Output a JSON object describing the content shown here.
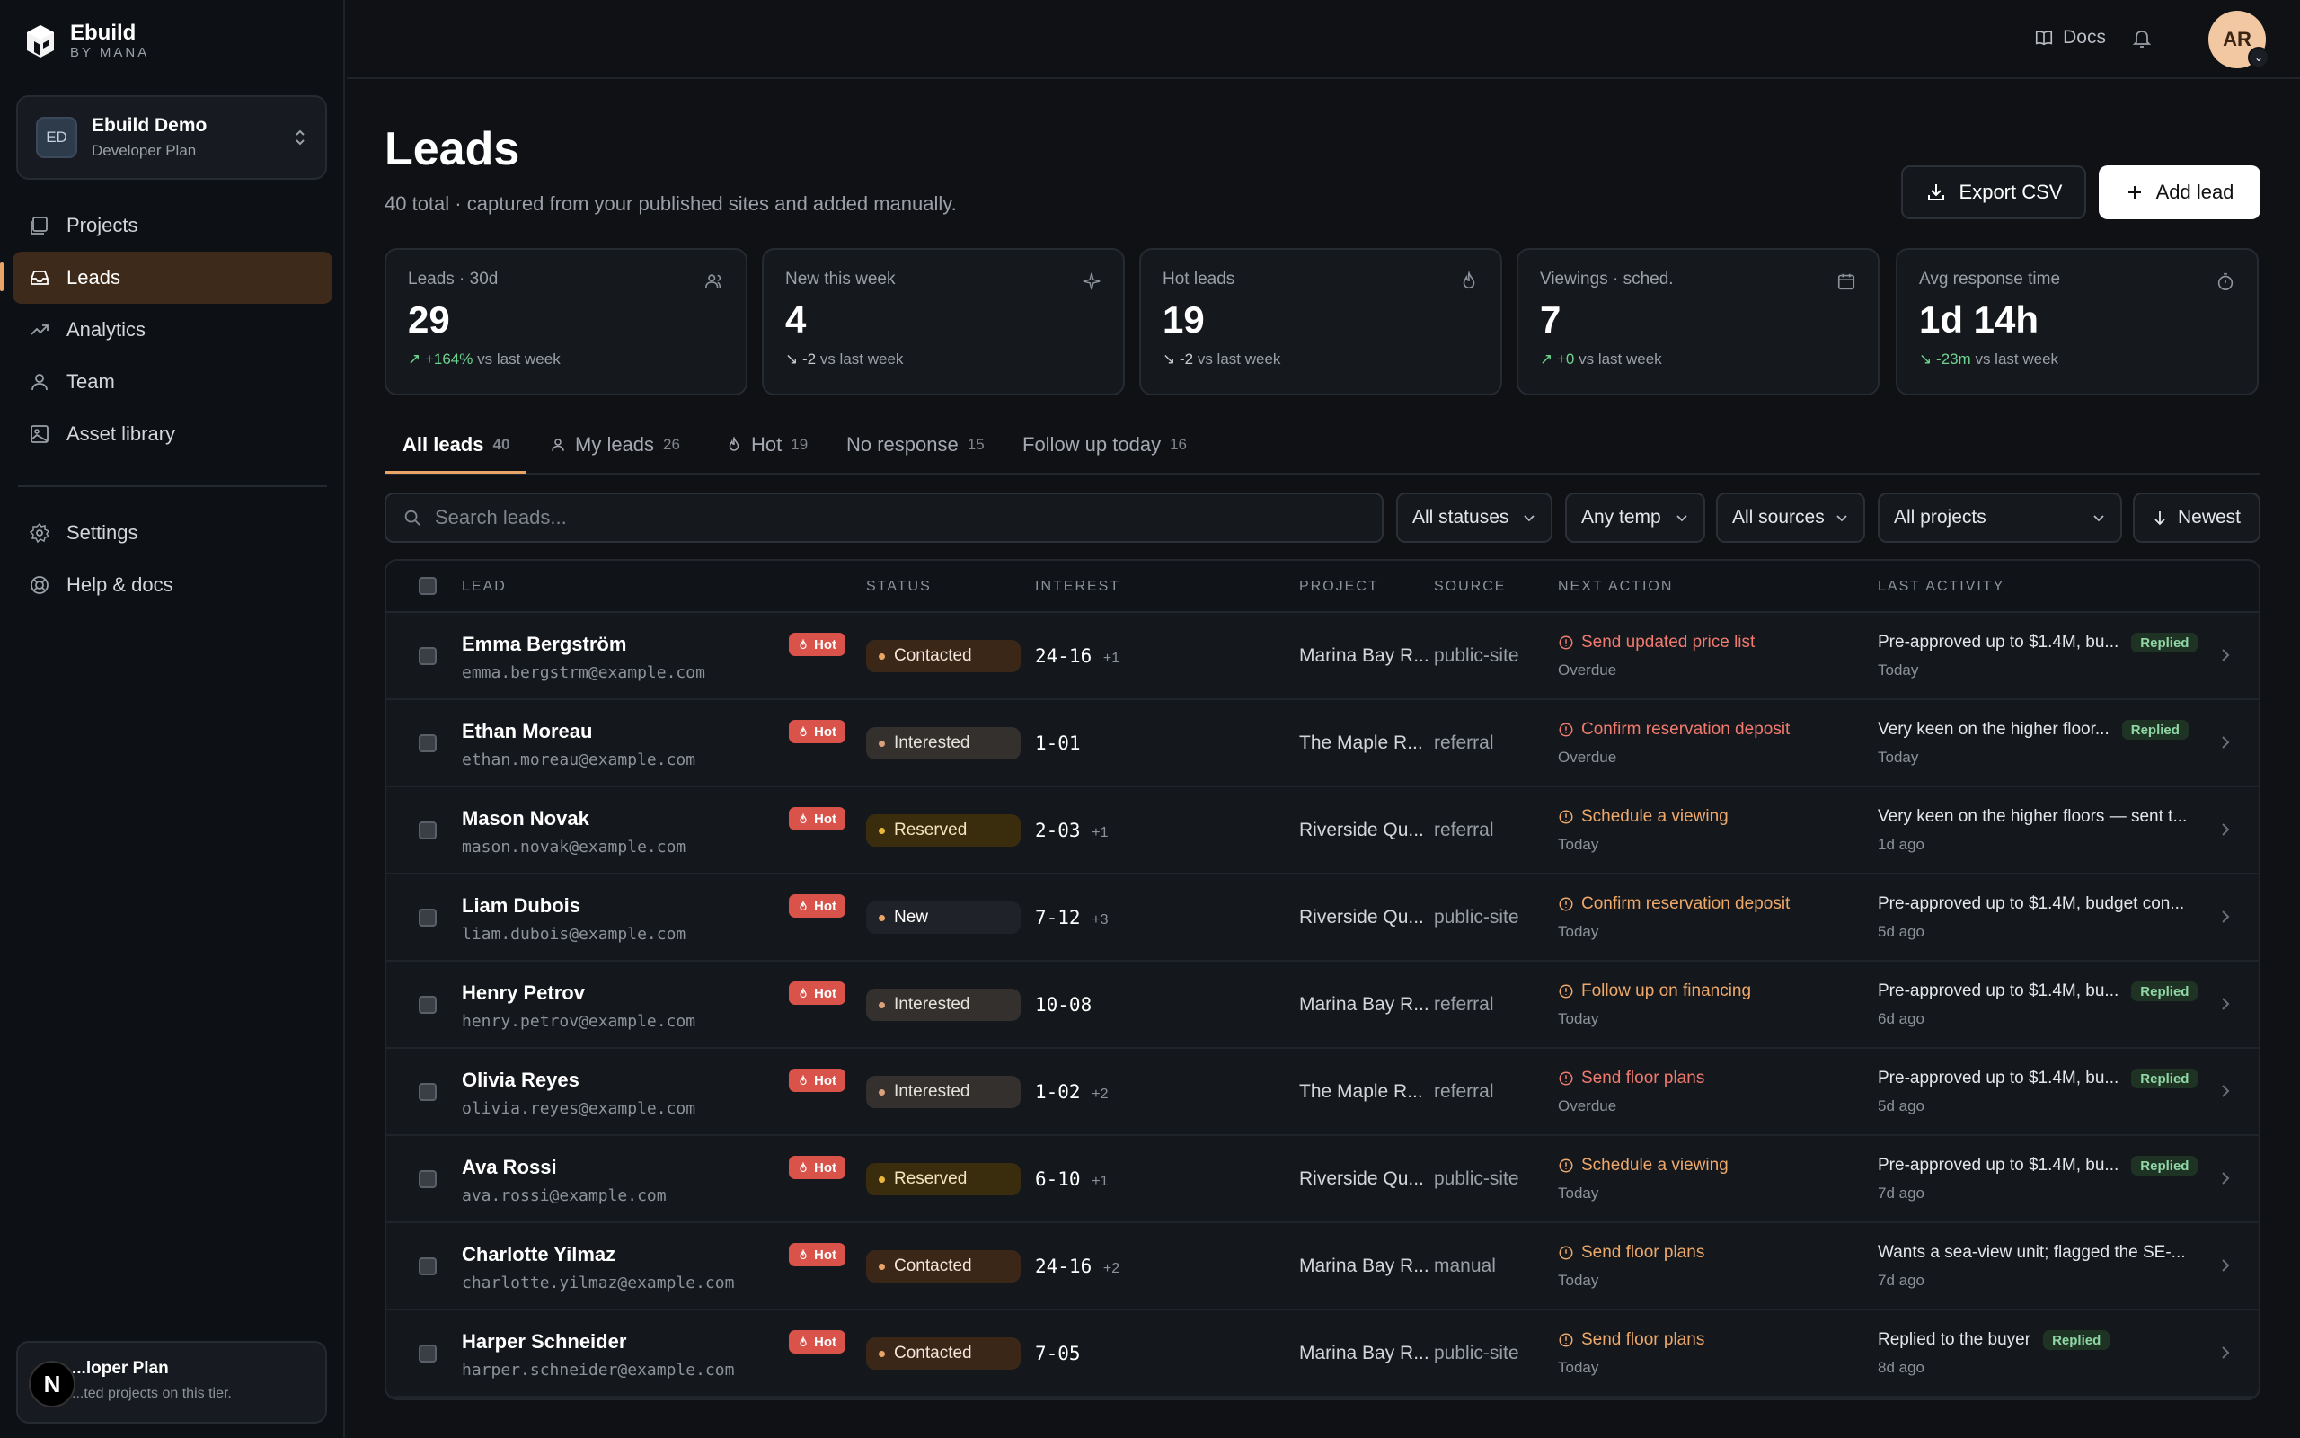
{
  "brand": {
    "name": "Ebuild",
    "sub": "BY MANA"
  },
  "workspace": {
    "initials": "ED",
    "name": "Ebuild Demo",
    "plan": "Developer Plan"
  },
  "nav": {
    "projects": "Projects",
    "leads": "Leads",
    "analytics": "Analytics",
    "team": "Team",
    "assets": "Asset library",
    "settings": "Settings",
    "help": "Help & docs"
  },
  "plan_card": {
    "badge": "N",
    "title": "...loper Plan",
    "sub": "...ted projects on this tier."
  },
  "topbar": {
    "docs": "Docs",
    "avatar": "AR"
  },
  "header": {
    "title": "Leads",
    "subtitle": "40 total · captured from your published sites and added manually.",
    "export": "Export CSV",
    "add": "Add lead"
  },
  "stats": [
    {
      "label": "Leads · 30d",
      "value": "29",
      "delta": "+164%",
      "delta_suffix": "vs last week",
      "dir": "up"
    },
    {
      "label": "New this week",
      "value": "4",
      "delta": "-2",
      "delta_suffix": "vs last week",
      "dir": "down"
    },
    {
      "label": "Hot leads",
      "value": "19",
      "delta": "-2",
      "delta_suffix": "vs last week",
      "dir": "down"
    },
    {
      "label": "Viewings · sched.",
      "value": "7",
      "delta": "+0",
      "delta_suffix": "vs last week",
      "dir": "up"
    },
    {
      "label": "Avg response time",
      "value": "1d 14h",
      "delta": "-23m",
      "delta_suffix": "vs last week",
      "dir": "up"
    }
  ],
  "tabs": [
    {
      "label": "All leads",
      "count": "40"
    },
    {
      "label": "My leads",
      "count": "26"
    },
    {
      "label": "Hot",
      "count": "19"
    },
    {
      "label": "No response",
      "count": "15"
    },
    {
      "label": "Follow up today",
      "count": "16"
    }
  ],
  "filters": {
    "search_placeholder": "Search leads...",
    "status": "All statuses",
    "temp": "Any temp",
    "source": "All sources",
    "project": "All projects",
    "sort": "Newest"
  },
  "columns": {
    "lead": "LEAD",
    "status": "STATUS",
    "interest": "INTEREST",
    "project": "PROJECT",
    "source": "SOURCE",
    "next": "NEXT ACTION",
    "last": "LAST ACTIVITY"
  },
  "hot_label": "Hot",
  "replied_label": "Replied",
  "rows": [
    {
      "name": "Emma Bergström",
      "email": "emma.bergstrm@example.com",
      "status": "Contacted",
      "status_key": "contacted",
      "unit": "24-16",
      "more": "+1",
      "project": "Marina Bay R...",
      "source": "public-site",
      "action": "Send updated price list",
      "action_type": "overdue",
      "action_when": "Overdue",
      "activity": "Pre-approved up to $1.4M, bu...",
      "replied": true,
      "activity_when": "Today"
    },
    {
      "name": "Ethan Moreau",
      "email": "ethan.moreau@example.com",
      "status": "Interested",
      "status_key": "interested",
      "unit": "1-01",
      "more": "",
      "project": "The Maple R...",
      "source": "referral",
      "action": "Confirm reservation deposit",
      "action_type": "overdue",
      "action_when": "Overdue",
      "activity": "Very keen on the higher floor...",
      "replied": true,
      "activity_when": "Today"
    },
    {
      "name": "Mason Novak",
      "email": "mason.novak@example.com",
      "status": "Reserved",
      "status_key": "reserved",
      "unit": "2-03",
      "more": "+1",
      "project": "Riverside Qu...",
      "source": "referral",
      "action": "Schedule a viewing",
      "action_type": "today",
      "action_when": "Today",
      "activity": "Very keen on the higher floors — sent t...",
      "replied": false,
      "activity_when": "1d ago"
    },
    {
      "name": "Liam Dubois",
      "email": "liam.dubois@example.com",
      "status": "New",
      "status_key": "new",
      "unit": "7-12",
      "more": "+3",
      "project": "Riverside Qu...",
      "source": "public-site",
      "action": "Confirm reservation deposit",
      "action_type": "today",
      "action_when": "Today",
      "activity": "Pre-approved up to $1.4M, budget con...",
      "replied": false,
      "activity_when": "5d ago"
    },
    {
      "name": "Henry Petrov",
      "email": "henry.petrov@example.com",
      "status": "Interested",
      "status_key": "interested",
      "unit": "10-08",
      "more": "",
      "project": "Marina Bay R...",
      "source": "referral",
      "action": "Follow up on financing",
      "action_type": "today",
      "action_when": "Today",
      "activity": "Pre-approved up to $1.4M, bu...",
      "replied": true,
      "activity_when": "6d ago"
    },
    {
      "name": "Olivia Reyes",
      "email": "olivia.reyes@example.com",
      "status": "Interested",
      "status_key": "interested",
      "unit": "1-02",
      "more": "+2",
      "project": "The Maple R...",
      "source": "referral",
      "action": "Send floor plans",
      "action_type": "overdue",
      "action_when": "Overdue",
      "activity": "Pre-approved up to $1.4M, bu...",
      "replied": true,
      "activity_when": "5d ago"
    },
    {
      "name": "Ava Rossi",
      "email": "ava.rossi@example.com",
      "status": "Reserved",
      "status_key": "reserved",
      "unit": "6-10",
      "more": "+1",
      "project": "Riverside Qu...",
      "source": "public-site",
      "action": "Schedule a viewing",
      "action_type": "today",
      "action_when": "Today",
      "activity": "Pre-approved up to $1.4M, bu...",
      "replied": true,
      "activity_when": "7d ago"
    },
    {
      "name": "Charlotte Yilmaz",
      "email": "charlotte.yilmaz@example.com",
      "status": "Contacted",
      "status_key": "contacted",
      "unit": "24-16",
      "more": "+2",
      "project": "Marina Bay R...",
      "source": "manual",
      "action": "Send floor plans",
      "action_type": "today",
      "action_when": "Today",
      "activity": "Wants a sea-view unit; flagged the SE-...",
      "replied": false,
      "activity_when": "7d ago"
    },
    {
      "name": "Harper Schneider",
      "email": "harper.schneider@example.com",
      "status": "Contacted",
      "status_key": "contacted",
      "unit": "7-05",
      "more": "",
      "project": "Marina Bay R...",
      "source": "public-site",
      "action": "Send floor plans",
      "action_type": "today",
      "action_when": "Today",
      "activity": "Replied to the buyer",
      "replied": true,
      "activity_when": "8d ago"
    }
  ]
}
